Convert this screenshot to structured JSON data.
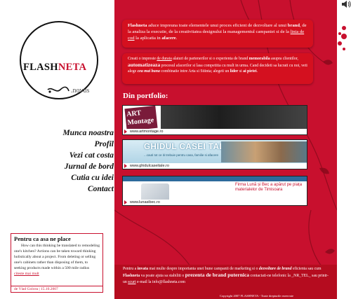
{
  "logo": {
    "text_main": "FLASH",
    "text_accent": "NETA",
    "subtitle": ".novus"
  },
  "nav": {
    "items": [
      {
        "label": "Munca noastra"
      },
      {
        "label": "Profil"
      },
      {
        "label": "Vezi cat costa"
      },
      {
        "label": "Jurnal de bord"
      },
      {
        "label": "Cutia cu idei"
      },
      {
        "label": "Contact"
      }
    ]
  },
  "side_box": {
    "title": "Pentru ca asa ne place",
    "text": "How can this thinking be translated to remodeling one's kitchen? Actions can be taken toward thinking holistically about a project. From deleting or selling one's cabinets rather than disposing of them, to seeking products made within a 500 mile radius",
    "more_link": "citeste mai mult",
    "author": "de Vlad Golcea | 15.10.2007"
  },
  "intro1": {
    "p1": "Flashneta",
    "p2": " aduce impreuna toate elementele unui proces eficient de dezvoltare al unui ",
    "p3": "brand",
    "p4": ", de la analiza la executie, de la creativitatea designului la managementul campaniei si de la ",
    "p5": "linia de cod",
    "p6": " la aplicatia in ",
    "p7": "afacere",
    "p8": "."
  },
  "intro2": {
    "p1": "Creati o impresie ",
    "p2": "de durata",
    "p3": " alaturi de partenerilor si o experienta de brand ",
    "p4": "memorabila",
    "p5": " asupra clientilor, ",
    "p6": "automatizeaza",
    "p7": " procesul afacerilor si lasa competitia cu mult in urma. Cand decideti sa lucrati cu noi, veti alege ",
    "p8": "cea mai buna",
    "p9": " combinatie intre Arta si Stiinta; alegeti un ",
    "p10": "lider",
    "p11": " si ",
    "p12": "ai pietei",
    "p13": "."
  },
  "portfolio": {
    "title": "Din portfolio:",
    "items": [
      {
        "url": "www.artmontage.ro",
        "logo_line1": "ART",
        "logo_line2": "Montage"
      },
      {
        "url": "www.ghidulcaseitale.ro",
        "title": "GHIDUL CASEI TALE",
        "subtitle": "...cauti tot ce iti trebuie pentru casa, familie si afacere"
      },
      {
        "url": "www.lunasibec.ro",
        "slogan": "Firma Lună și Bec a apărut pe piața materialelor de Timisoara"
      }
    ]
  },
  "bottom_card": {
    "p1": "Pentru a ",
    "p2": "invata",
    "p3": " mai multe despre importanta unei bune campanii de marketing si o ",
    "p4": "dezvoltare de brand",
    "p5": " eficienta sau cum ",
    "p6": "Flashneta",
    "p7": " va poate ajuta sa stabiliti o ",
    "p8": "prezenta de brand puternica",
    "p9": " contactati-ne telefonic la _NR_TEL_ sau printr-un ",
    "p10": "scurt",
    "p11": " e-mail la info@flashneta.com"
  },
  "copyright": "Copyright 2007 FLASHNETA - Toate drepturile rezervate",
  "icons": {
    "speaker": "speaker-icon",
    "dots": "dots-decoration-icon"
  },
  "colors": {
    "brand_red": "#c8102e"
  }
}
